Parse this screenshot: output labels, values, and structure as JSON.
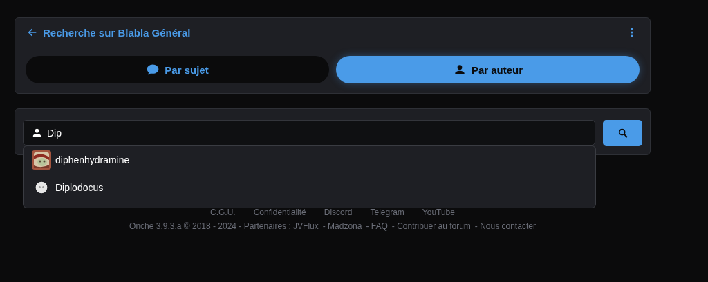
{
  "header": {
    "title": "Recherche sur Blabla Général"
  },
  "tabs": [
    {
      "label": "Par sujet",
      "selected": false
    },
    {
      "label": "Par auteur",
      "selected": true
    }
  ],
  "search": {
    "value": "Dip"
  },
  "suggestions": [
    {
      "name": "diphenhydramine",
      "kind": "picture"
    },
    {
      "name": "Diplodocus",
      "kind": "default"
    }
  ],
  "footer": {
    "links": [
      "C.G.U.",
      "Confidentialité",
      "Discord",
      "Telegram",
      "YouTube"
    ],
    "credits": [
      "Onche 3.9.3.a © 2018 - 2024 - Partenaires : JVFlux",
      "- Madzona",
      "- FAQ",
      "- Contribuer au forum",
      "- Nous contacter"
    ]
  }
}
